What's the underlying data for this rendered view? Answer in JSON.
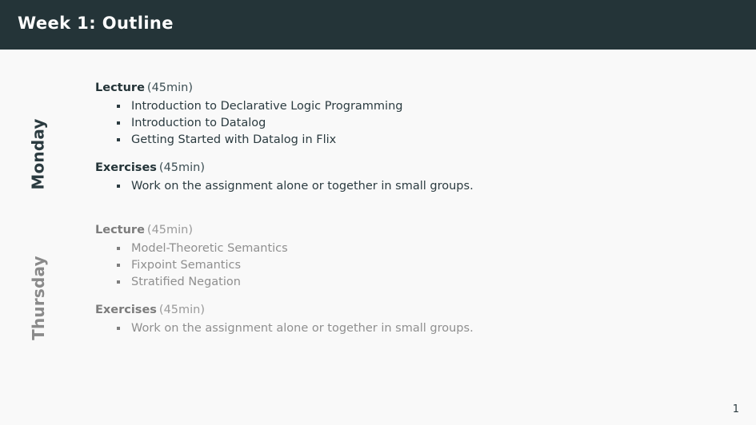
{
  "header": {
    "title": "Week 1:  Outline",
    "background_color": "#243438",
    "text_color": "#ffffff"
  },
  "slide": {
    "background_color": "#f9f9f9",
    "page_number": "1"
  },
  "sections": [
    {
      "id": "monday",
      "day_label": "Monday",
      "state": "active",
      "accent_color": "#2b3b40",
      "blocks": [
        {
          "title": "Lecture",
          "duration": "(45min)",
          "items": [
            "Introduction to Declarative Logic Programming",
            "Introduction to Datalog",
            "Getting Started with Datalog in Flix"
          ]
        },
        {
          "title": "Exercises",
          "duration": "(45min)",
          "items": [
            "Work on the assignment alone or together in small groups."
          ]
        }
      ]
    },
    {
      "id": "thursday",
      "day_label": "Thursday",
      "state": "dimmed",
      "accent_color": "#8a8a8a",
      "blocks": [
        {
          "title": "Lecture",
          "duration": "(45min)",
          "items": [
            "Model-Theoretic Semantics",
            "Fixpoint Semantics",
            "Stratified Negation"
          ]
        },
        {
          "title": "Exercises",
          "duration": "(45min)",
          "items": [
            "Work on the assignment alone or together in small groups."
          ]
        }
      ]
    }
  ]
}
